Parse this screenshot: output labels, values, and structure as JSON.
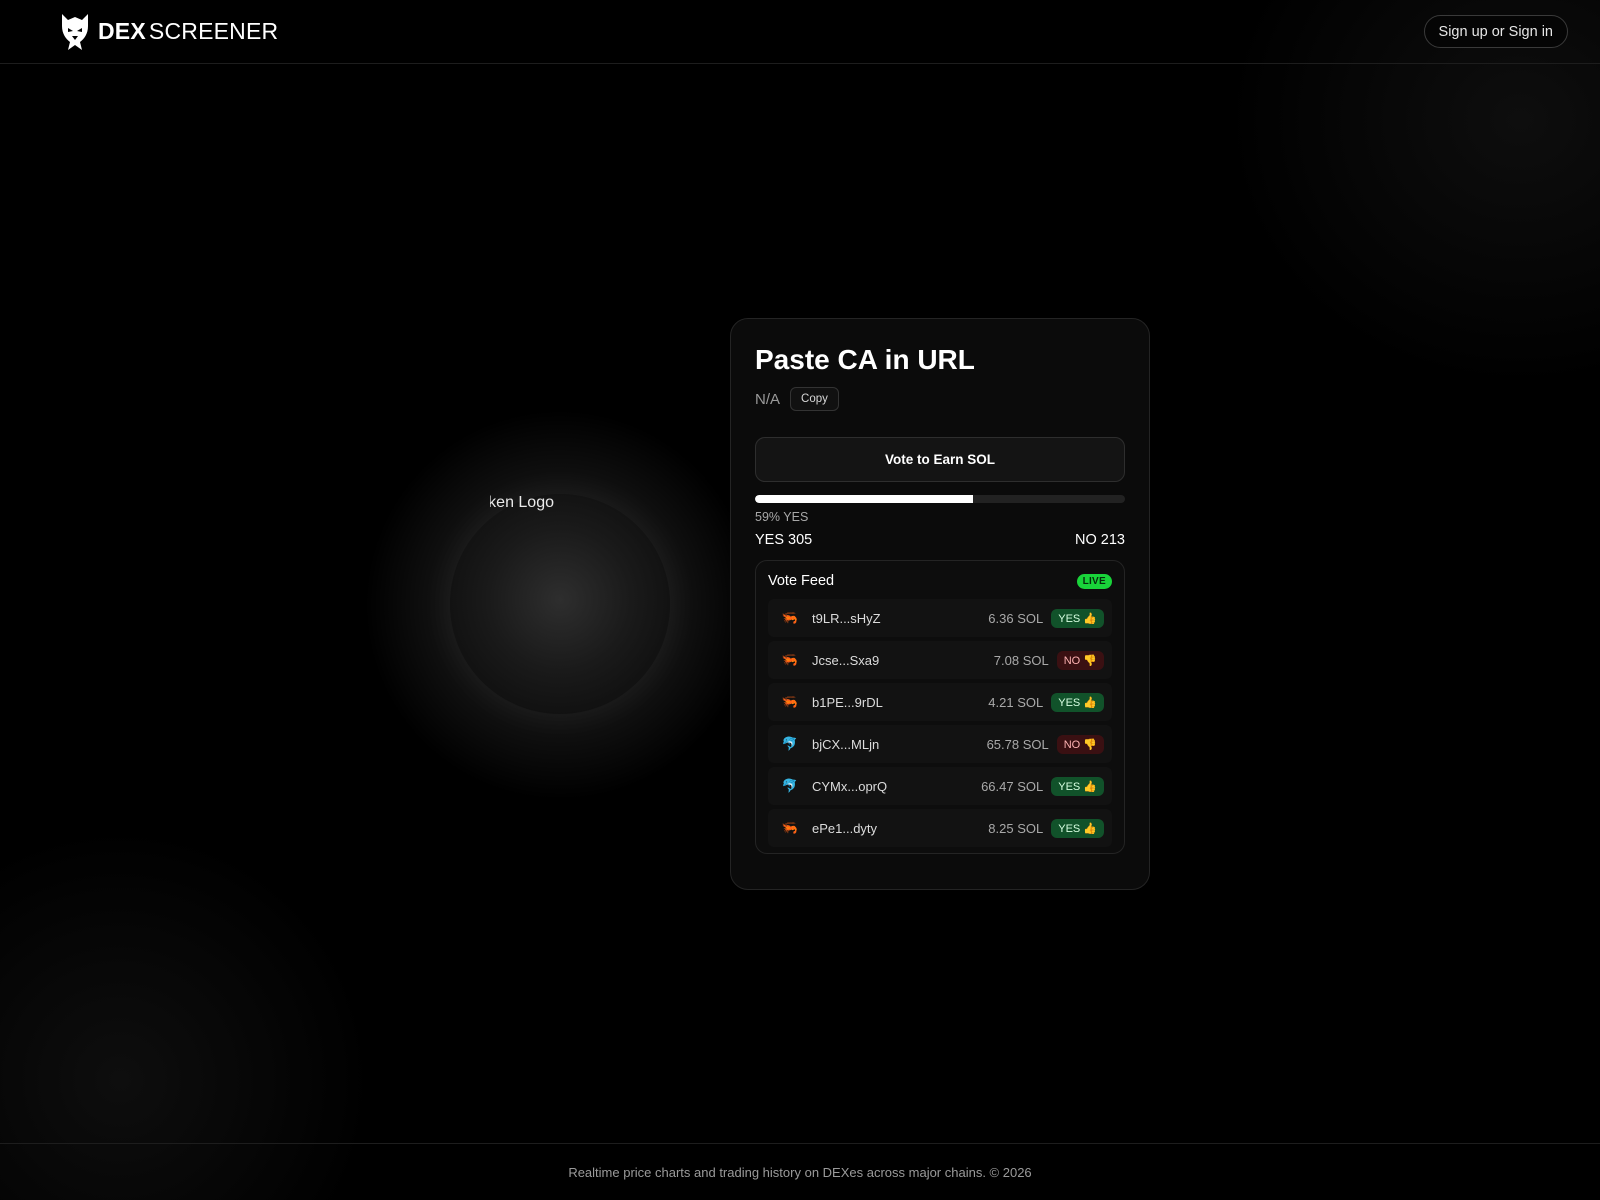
{
  "header": {
    "brand_dex": "DEX",
    "brand_screener": "SCREENER",
    "signin_label": "Sign up or Sign in"
  },
  "hero": {
    "logo_alt": "Token Logo"
  },
  "card": {
    "title": "Paste CA in URL",
    "contract_address": "N/A",
    "copy_label": "Copy",
    "vote_button_label": "Vote to Earn SOL",
    "yes_fraction": 0.59,
    "yes_percent_label": "59% YES",
    "yes_count_label": "YES 305",
    "no_count_label": "NO 213"
  },
  "feed": {
    "title": "Vote Feed",
    "live_label": "LIVE",
    "rows": [
      {
        "icon": "shrimp-icon",
        "glyph": "🦐",
        "address": "t9LR...sHyZ",
        "amount": "6.36 SOL",
        "vote": "YES 👍",
        "kind": "yes"
      },
      {
        "icon": "shrimp-icon",
        "glyph": "🦐",
        "address": "Jcse...Sxa9",
        "amount": "7.08 SOL",
        "vote": "NO 👎",
        "kind": "no"
      },
      {
        "icon": "shrimp-icon",
        "glyph": "🦐",
        "address": "b1PE...9rDL",
        "amount": "4.21 SOL",
        "vote": "YES 👍",
        "kind": "yes"
      },
      {
        "icon": "dolphin-icon",
        "glyph": "🐬",
        "address": "bjCX...MLjn",
        "amount": "65.78 SOL",
        "vote": "NO 👎",
        "kind": "no"
      },
      {
        "icon": "dolphin-icon",
        "glyph": "🐬",
        "address": "CYMx...oprQ",
        "amount": "66.47 SOL",
        "vote": "YES 👍",
        "kind": "yes"
      },
      {
        "icon": "shrimp-icon",
        "glyph": "🦐",
        "address": "ePe1...dyty",
        "amount": "8.25 SOL",
        "vote": "YES 👍",
        "kind": "yes"
      }
    ]
  },
  "footer": {
    "text": "Realtime price charts and trading history on DEXes across major chains. © 2026"
  },
  "colors": {
    "live": "#19d43a",
    "yes_badge": "#11522a",
    "no_badge": "#3a1012"
  }
}
